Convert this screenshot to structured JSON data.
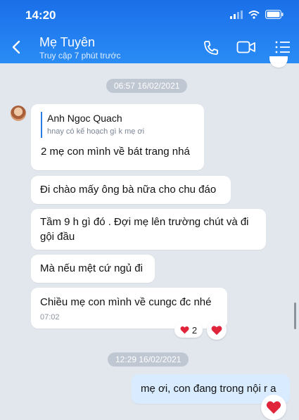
{
  "status_bar": {
    "time": "14:20"
  },
  "header": {
    "title": "Mẹ Tuyên",
    "subtitle": "Truy cập 7 phút trước"
  },
  "icons": {
    "back": "chevron-left-icon",
    "call": "phone-icon",
    "video": "video-icon",
    "menu": "list-menu-icon"
  },
  "colors": {
    "header": "#1f7cf0",
    "chat_bg": "#e2e7ee",
    "outgoing": "#d9ecff",
    "heart": "#e0243a"
  },
  "messages": {
    "stamp1": "06:57 16/02/2021",
    "m1": {
      "quote_author": "Anh Ngoc Quach",
      "quote_text": "hnay có kế hoạch gì k mẹ ơi",
      "text": "2 mẹ con mình về bát trang nhá"
    },
    "m2": "Đi chào mấy ông bà nữa cho chu đáo",
    "m3": "Tầm 9 h gì đó . Đợi mẹ lên trường chút và đi gội đầu",
    "m4": "Mà nếu mệt cứ ngủ đi",
    "m5": {
      "text": "Chiều mẹ con mình về cungc đc nhé",
      "time": "07:02",
      "reaction_count": "2"
    },
    "stamp2": "12:29 16/02/2021",
    "m6": "mẹ ơi, con đang trong nội r a"
  }
}
